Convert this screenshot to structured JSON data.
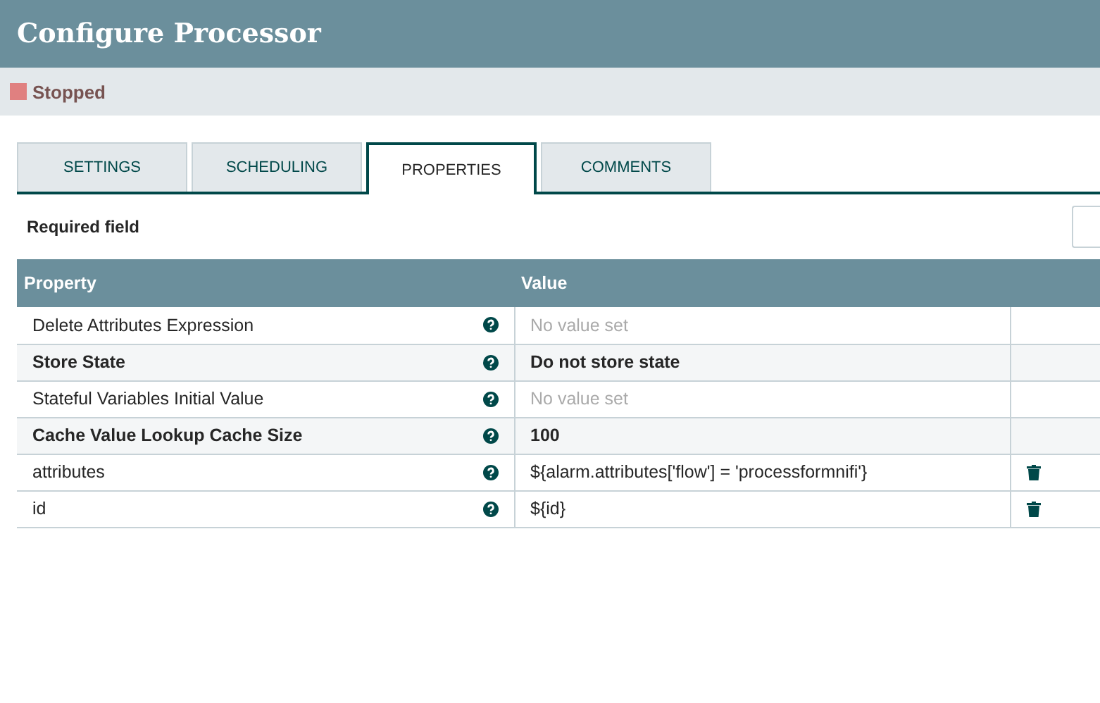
{
  "window": {
    "title": "Configure Processor"
  },
  "status": {
    "label": "Stopped",
    "color": "#e08080"
  },
  "tabs": [
    {
      "label": "SETTINGS",
      "selected": false
    },
    {
      "label": "SCHEDULING",
      "selected": false
    },
    {
      "label": "PROPERTIES",
      "selected": true
    },
    {
      "label": "COMMENTS",
      "selected": false
    }
  ],
  "required_note": "Required field",
  "table": {
    "columns": [
      "Property",
      "Value"
    ],
    "rows": [
      {
        "property": "Delete Attributes Expression",
        "required": false,
        "value": "No value set",
        "unset": true,
        "deletable": false
      },
      {
        "property": "Store State",
        "required": true,
        "value": "Do not store state",
        "unset": false,
        "deletable": false
      },
      {
        "property": "Stateful Variables Initial Value",
        "required": false,
        "value": "No value set",
        "unset": true,
        "deletable": false
      },
      {
        "property": "Cache Value Lookup Cache Size",
        "required": true,
        "value": "100",
        "unset": false,
        "deletable": false
      },
      {
        "property": "attributes",
        "required": false,
        "value": "${alarm.attributes['flow'] = 'processformnifi'}",
        "unset": false,
        "deletable": true
      },
      {
        "property": "id",
        "required": false,
        "value": "${id}",
        "unset": false,
        "deletable": true
      }
    ]
  }
}
